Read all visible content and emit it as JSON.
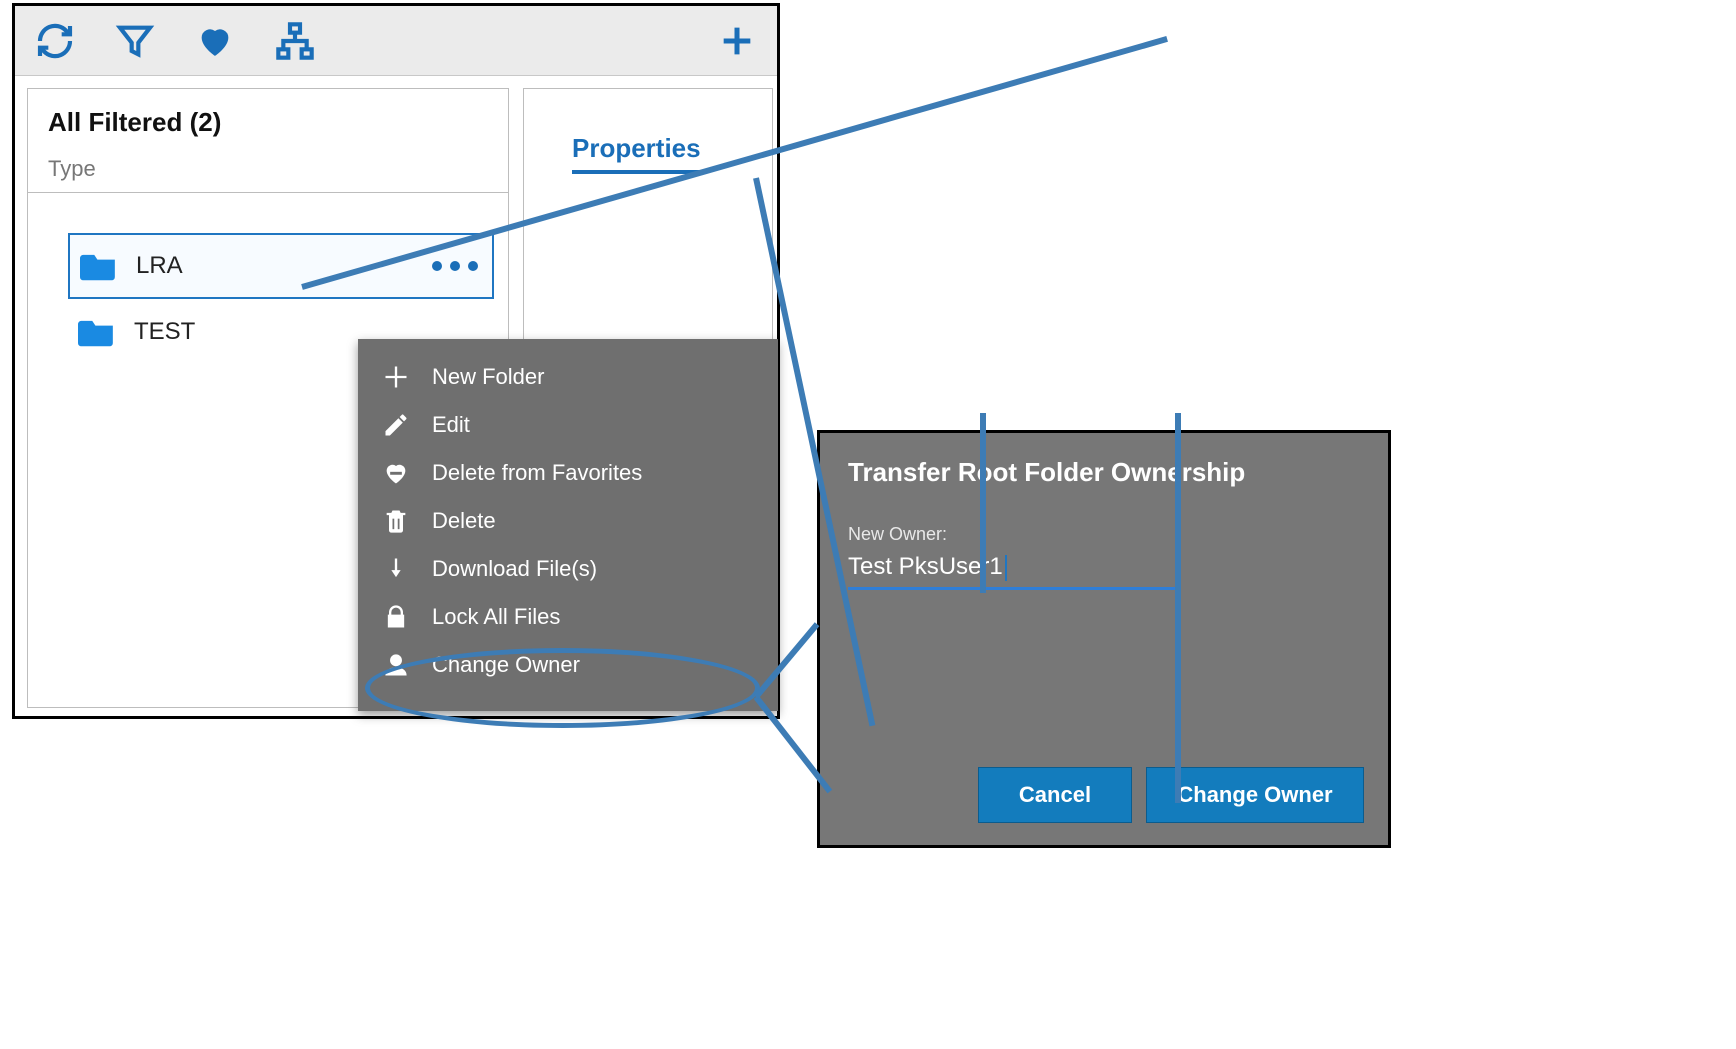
{
  "toolbar": {
    "refresh_icon": "refresh",
    "filter_icon": "filter",
    "favorite_icon": "heart",
    "tree_icon": "tree",
    "add_icon": "plus"
  },
  "list": {
    "title": "All Filtered (2)",
    "column_header": "Type",
    "items": [
      {
        "label": "LRA",
        "selected": true
      },
      {
        "label": "TEST",
        "selected": false
      }
    ]
  },
  "properties": {
    "tab_label": "Properties"
  },
  "context_menu": {
    "items": [
      {
        "icon": "plus",
        "label": "New Folder"
      },
      {
        "icon": "pencil",
        "label": "Edit"
      },
      {
        "icon": "heart-off",
        "label": "Delete from Favorites"
      },
      {
        "icon": "trash",
        "label": "Delete"
      },
      {
        "icon": "download",
        "label": "Download File(s)"
      },
      {
        "icon": "lock",
        "label": "Lock All Files"
      },
      {
        "icon": "person",
        "label": "Change Owner"
      }
    ]
  },
  "dialog": {
    "title": "Transfer Root Folder Ownership",
    "field_label": "New Owner:",
    "field_value": "Test PksUser1",
    "cancel_label": "Cancel",
    "confirm_label": "Change Owner"
  }
}
